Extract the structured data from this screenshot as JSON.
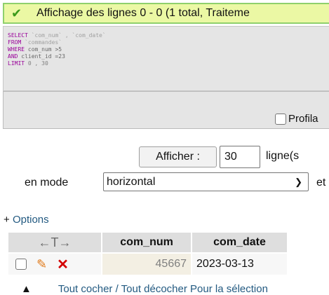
{
  "status": {
    "message": "Affichage des lignes 0 - 0 (1 total, Traiteme"
  },
  "sql": {
    "line1_kw": "SELECT",
    "line1_rest": " `com_num` , `com_date`",
    "line2_kw": "FROM",
    "line2_rest": " `commandes`",
    "line3_kw": "WHERE",
    "line3_rest": " com_num >5",
    "line4_kw": "AND",
    "line4_rest": " client_id =23",
    "line5_kw": "LIMIT",
    "line5_rest": " 0 , 30"
  },
  "profil_label": "Profila",
  "nav": {
    "afficher_label": "Afficher :",
    "rows_value": "30",
    "rows_after": "ligne(s",
    "mode_label": "en mode",
    "mode_value": "horizontal",
    "mode_after": "et"
  },
  "options_label": "Options",
  "table": {
    "arrows": "←T→",
    "columns": [
      "com_num",
      "com_date"
    ],
    "rows": [
      {
        "com_num": "45667",
        "com_date": "2023-03-13"
      }
    ]
  },
  "bottom_links": "Tout cocher / Tout décocher   Pour la sélection",
  "icons": {
    "check": "check-icon",
    "pencil": "pencil-icon",
    "delete": "delete-icon",
    "select_chevron": "chevron-down-icon"
  },
  "colors": {
    "success_bg": "#ebf8a4",
    "success_border": "#8fd06c",
    "sql_bg": "#e5e5e5",
    "link": "#235a81",
    "keyword": "#990099",
    "delete": "#d40000",
    "pencil": "#e07a1a"
  }
}
